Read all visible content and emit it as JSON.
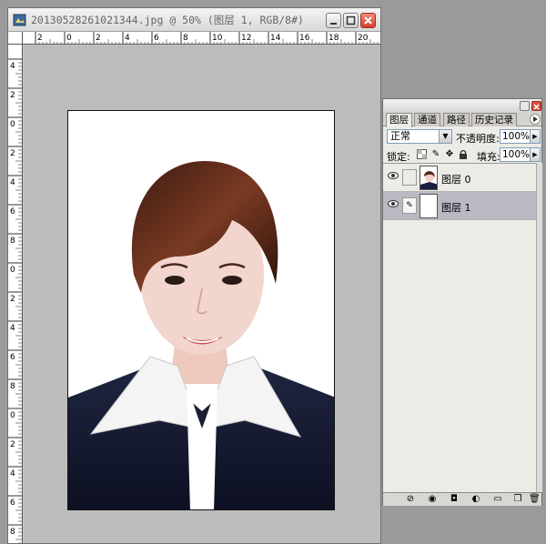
{
  "document": {
    "title": "20130528261021344.jpg @ 50% (图层 1, RGB/8#)",
    "ruler_top_labels": [
      "2",
      "0",
      "2",
      "4",
      "6",
      "8",
      "10",
      "12",
      "14",
      "16",
      "18",
      "20"
    ],
    "ruler_left_labels": [
      "4",
      "2",
      "0",
      "2",
      "4",
      "6",
      "8",
      "0",
      "2",
      "4",
      "6",
      "8",
      "0",
      "2",
      "4",
      "6",
      "8"
    ]
  },
  "layers_panel": {
    "tabs": [
      "图层",
      "通道",
      "路径",
      "历史记录"
    ],
    "blend_mode": "正常",
    "opacity_label": "不透明度:",
    "opacity_value": "100%",
    "lock_label": "锁定:",
    "fill_label": "填充:",
    "fill_value": "100%",
    "layers": [
      {
        "name": "图层 0",
        "visible": true,
        "selected": false
      },
      {
        "name": "图层 1",
        "visible": true,
        "selected": true
      }
    ]
  },
  "colors": {
    "canvas_bg": "#bcbcbc",
    "selected_layer": "#b9b9c3",
    "close_button": "#d4402c"
  }
}
